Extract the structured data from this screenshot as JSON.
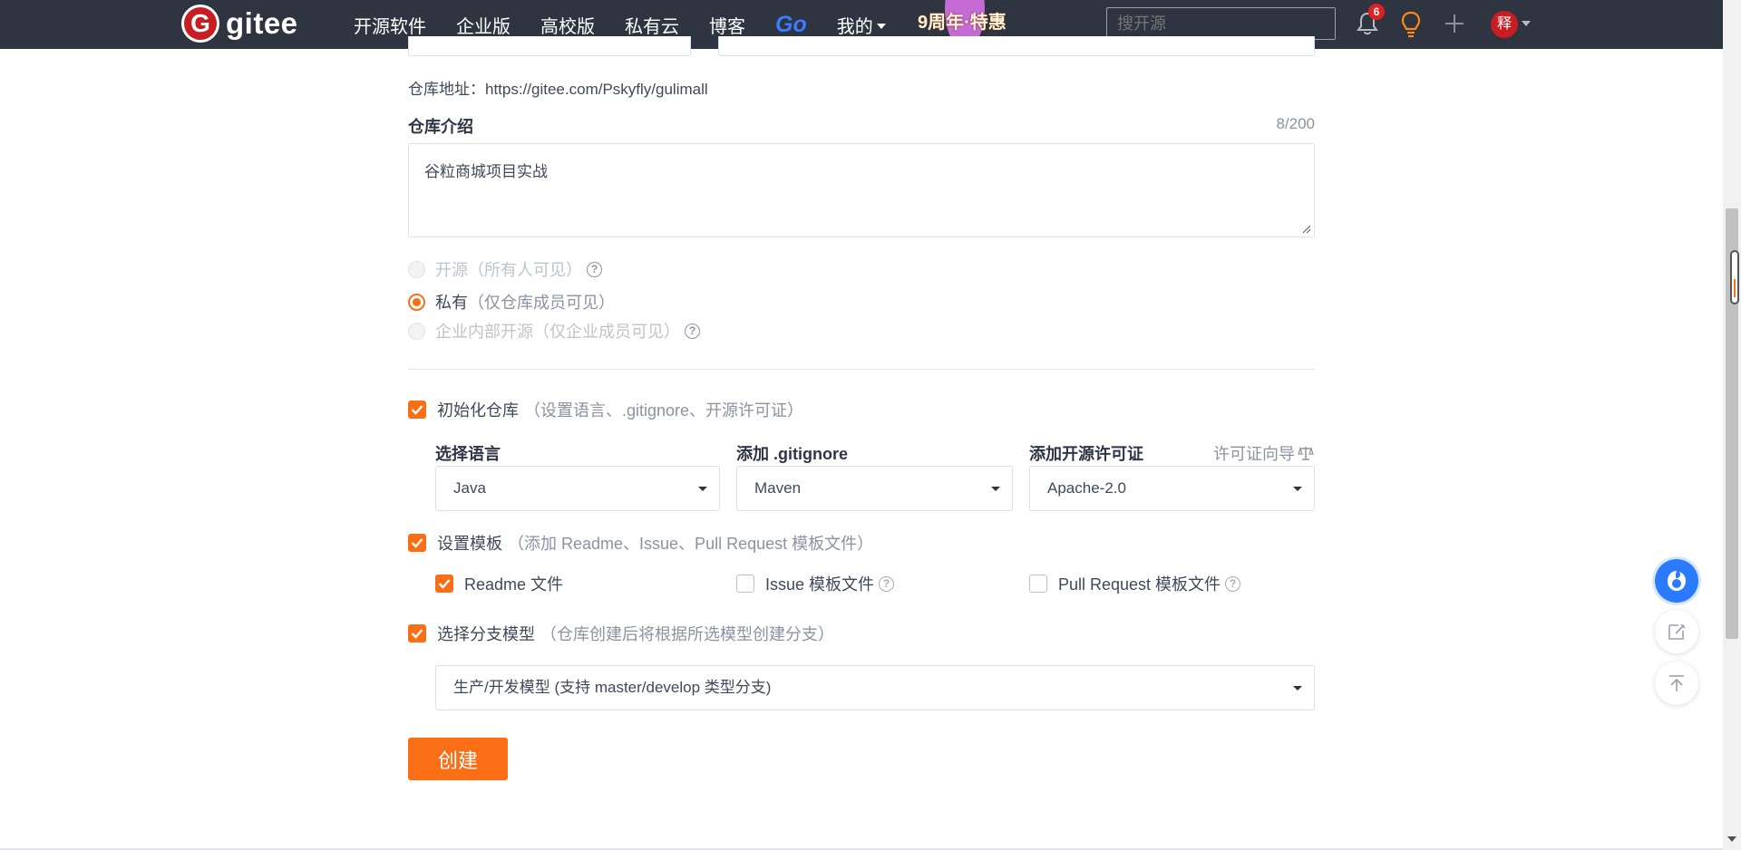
{
  "header": {
    "logo_mark": "G",
    "logo_text": "gitee",
    "nav": [
      "开源软件",
      "企业版",
      "高校版",
      "私有云",
      "博客"
    ],
    "nav_go": "Go",
    "nav_mine": "我的",
    "promo": "9周年·特惠",
    "search_placeholder": "搜开源",
    "notification_count": "6",
    "avatar_text": "释"
  },
  "form": {
    "repo_address": "仓库地址：https://gitee.com/Pskyfly/gulimall",
    "intro_label": "仓库介绍",
    "intro_counter": "8/200",
    "intro_value": "谷粒商城项目实战",
    "visibility": [
      {
        "label": "开源",
        "hint": "（所有人可见）",
        "selected": false,
        "disabled": true
      },
      {
        "label": "私有",
        "hint": "（仅仓库成员可见）",
        "selected": true,
        "disabled": false
      },
      {
        "label": "企业内部开源",
        "hint": "（仅企业成员可见）",
        "selected": false,
        "disabled": true
      }
    ],
    "init_repo": {
      "label": "初始化仓库",
      "hint": "（设置语言、.gitignore、开源许可证）",
      "checked": true
    },
    "language": {
      "label": "选择语言",
      "value": "Java"
    },
    "gitignore": {
      "label": "添加 .gitignore",
      "value": "Maven"
    },
    "license": {
      "label": "添加开源许可证",
      "value": "Apache-2.0",
      "guide": "许可证向导"
    },
    "template": {
      "label": "设置模板",
      "hint": "（添加 Readme、Issue、Pull Request 模板文件）",
      "checked": true
    },
    "template_files": [
      {
        "label": "Readme 文件",
        "checked": true
      },
      {
        "label": "Issue 模板文件",
        "checked": false
      },
      {
        "label": "Pull Request 模板文件",
        "checked": false
      }
    ],
    "branch_model": {
      "label": "选择分支模型",
      "hint": "（仓库创建后将根据所选模型创建分支）",
      "checked": true,
      "value": "生产/开发模型 (支持 master/develop 类型分支)"
    },
    "create_button": "创建"
  },
  "colors": {
    "accent": "#fa6e16",
    "header_bg": "#2e3440",
    "brand_red": "#c71d23"
  }
}
